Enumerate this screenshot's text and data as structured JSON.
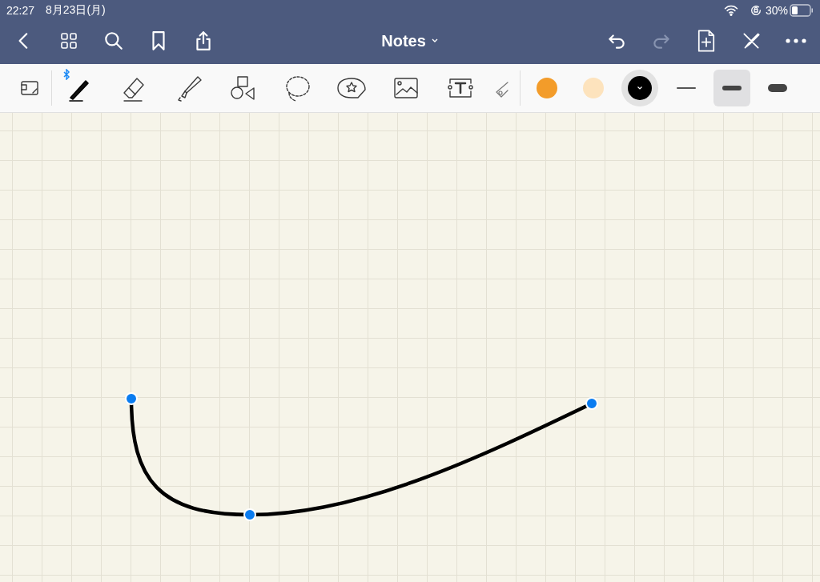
{
  "status_bar": {
    "time": "22:27",
    "date": "8月23日(月)",
    "battery": "30%"
  },
  "nav_bar": {
    "title": "Notes"
  },
  "tools": [
    {
      "kind": "select"
    },
    {
      "kind": "pen",
      "bluetooth": true
    },
    {
      "kind": "eraser"
    },
    {
      "kind": "highlighter"
    },
    {
      "kind": "shapes"
    },
    {
      "kind": "lasso"
    },
    {
      "kind": "sticker"
    },
    {
      "kind": "image"
    },
    {
      "kind": "text"
    },
    {
      "kind": "laser"
    }
  ],
  "colors": [
    {
      "color": "#f39c2a",
      "selected": false
    },
    {
      "color": "#fde3bd",
      "selected": false
    },
    {
      "color": "#000000",
      "selected": true
    }
  ],
  "widths": [
    {
      "kind": "thin",
      "selected": false
    },
    {
      "kind": "medium",
      "selected": true
    },
    {
      "kind": "thick",
      "selected": false
    }
  ]
}
